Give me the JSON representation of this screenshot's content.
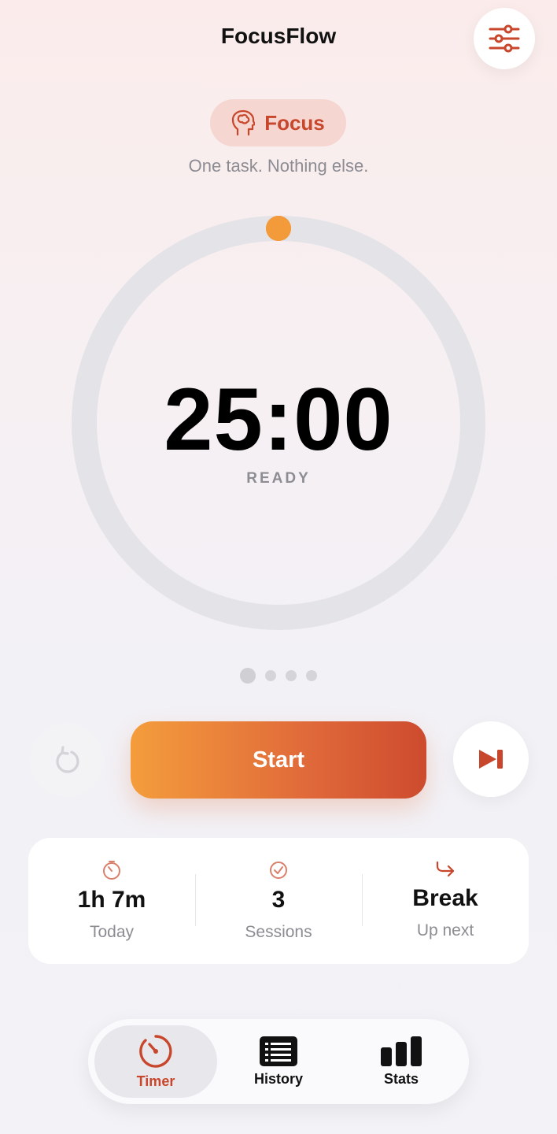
{
  "header": {
    "title": "FocusFlow"
  },
  "mode": {
    "label": "Focus",
    "subtitle": "One task. Nothing else."
  },
  "timer": {
    "time": "25:00",
    "status": "READY",
    "progress": 0
  },
  "session_dots": {
    "total": 4,
    "active_index": 0
  },
  "controls": {
    "start_label": "Start"
  },
  "stats": [
    {
      "value": "1h 7m",
      "caption": "Today",
      "icon": "stopwatch-icon"
    },
    {
      "value": "3",
      "caption": "Sessions",
      "icon": "check-circle-icon"
    },
    {
      "value": "Break",
      "caption": "Up next",
      "icon": "forward-arrow-icon"
    }
  ],
  "tabs": [
    {
      "label": "Timer",
      "icon": "timer-icon",
      "active": true
    },
    {
      "label": "History",
      "icon": "history-list-icon",
      "active": false
    },
    {
      "label": "Stats",
      "icon": "bar-chart-icon",
      "active": false
    }
  ],
  "colors": {
    "accent": "#c8462b",
    "knob": "#f39a3a",
    "ring": "#e4e3e7"
  }
}
